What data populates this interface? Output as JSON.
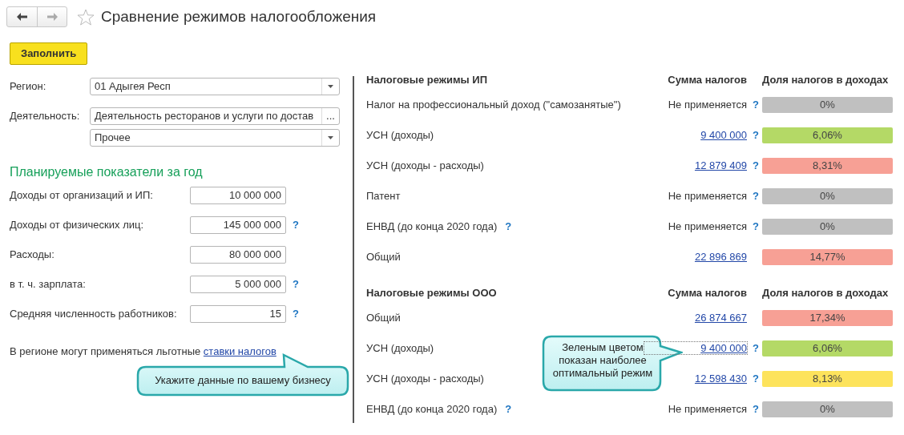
{
  "header": {
    "title": "Сравнение режимов налогообложения",
    "favorite": false
  },
  "fill_button": "Заполнить",
  "fields": [
    {
      "label": "Регион:",
      "value": "01 Адыгея Респ",
      "kind": "dropdown"
    },
    {
      "label": "Деятельность:",
      "value": "Деятельность ресторанов и услуги по достав",
      "kind": "choice",
      "choice_button": "..."
    },
    {
      "value": "Прочее",
      "kind": "dropdown"
    }
  ],
  "indicators_title": "Планируемые показатели за год",
  "indicators": [
    {
      "label": "Доходы от организаций и ИП:",
      "value": "10 000 000"
    },
    {
      "label": "Доходы от физических лиц:",
      "value": "145 000 000",
      "hint": "?"
    },
    {
      "label": "Расходы:",
      "value": "80 000 000"
    },
    {
      "label": "в т. ч. зарплата:",
      "value": "5 000 000",
      "hint": "?"
    },
    {
      "label": "Средняя численность работников:",
      "value": "15",
      "hint": "?"
    }
  ],
  "note": {
    "text": "В регионе могут применяться льготные",
    "link": "ставки налогов"
  },
  "sections": [
    {
      "title": "Налоговые режимы ИП",
      "sum_header": "Сумма налогов",
      "share_header": "Доля налогов в доходах",
      "rows": [
        {
          "name": "Налог на профессиональный доход (\"самозанятые\")",
          "sum": "Не применяется",
          "sum_link": false,
          "sum_hint": "?",
          "share": "0%",
          "color": "#c0c0c0"
        },
        {
          "name": "УСН (доходы)",
          "sum": "9 400 000",
          "sum_link": true,
          "sum_hint": "?",
          "share": "6,06%",
          "color": "#b4d966"
        },
        {
          "name": "УСН (доходы - расходы)",
          "sum": "12 879 409",
          "sum_link": true,
          "sum_hint": "?",
          "share": "8,31%",
          "color": "#f7a095"
        },
        {
          "name": "Патент",
          "sum": "Не применяется",
          "sum_link": false,
          "sum_hint": "?",
          "share": "0%",
          "color": "#c0c0c0"
        },
        {
          "name": "ЕНВД (до конца 2020 года)",
          "name_hint": "?",
          "sum": "Не применяется",
          "sum_link": false,
          "sum_hint": "?",
          "share": "0%",
          "color": "#c0c0c0"
        },
        {
          "name": "Общий",
          "sum": "22 896 869",
          "sum_link": true,
          "share": "14,77%",
          "color": "#f7a095"
        }
      ]
    },
    {
      "title": "Налоговые режимы ООО",
      "sum_header": "Сумма налогов",
      "share_header": "Доля налогов в доходах",
      "rows": [
        {
          "name": "Общий",
          "sum": "26 874 667",
          "sum_link": true,
          "share": "17,34%",
          "color": "#f7a095"
        },
        {
          "name": "УСН (доходы)",
          "sum": "9 400 000",
          "sum_link": true,
          "sum_hint": "?",
          "share": "6,06%",
          "color": "#b4d966",
          "focused": true
        },
        {
          "name": "УСН (доходы - расходы)",
          "sum": "12 598 430",
          "sum_link": true,
          "sum_hint": "?",
          "share": "8,13%",
          "color": "#fde35c"
        },
        {
          "name": "ЕНВД (до конца 2020 года)",
          "name_hint": "?",
          "sum": "Не применяется",
          "sum_link": false,
          "sum_hint": "?",
          "share": "0%",
          "color": "#c0c0c0"
        }
      ]
    }
  ],
  "callouts": [
    {
      "text": "Укажите данные по вашему бизнесу",
      "kind": "hint"
    },
    {
      "text": "Зеленым цветом показан наиболее оптимальный режим",
      "kind": "note"
    }
  ]
}
